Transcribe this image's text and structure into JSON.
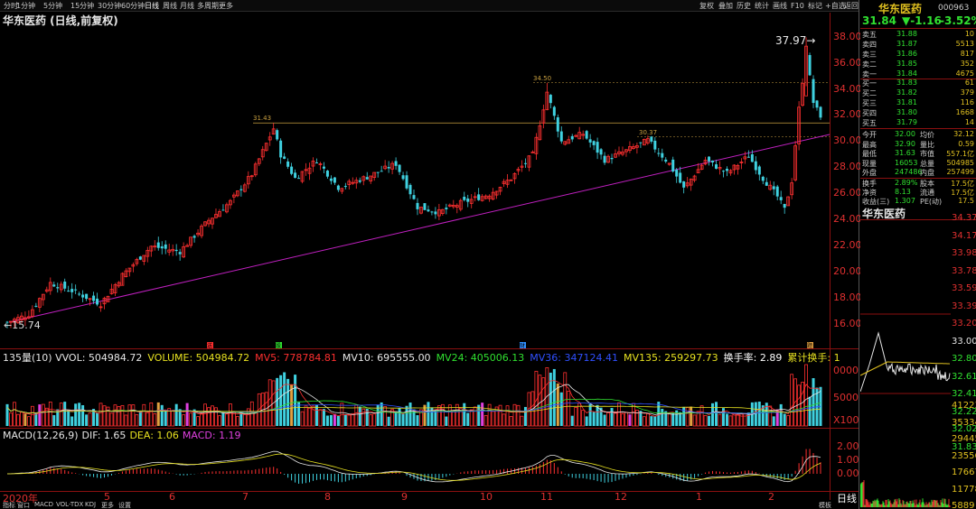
{
  "toolbar": {
    "left_tabs": [
      "分时",
      "1分钟",
      "5分钟",
      "15分钟",
      "30分钟",
      "60分钟",
      "日线",
      "周线",
      "月线",
      "多周期",
      "更多"
    ],
    "active_tab": "日线",
    "right_tabs": [
      "复权",
      "叠加",
      "历史",
      "统计",
      "画线",
      "F10",
      "标记",
      "+自选",
      "返回"
    ]
  },
  "main_title": "华东医药 (日线,前复权)",
  "colors": {
    "up": "#ff3030",
    "down": "#3fd1e0",
    "trendline": "#c020c0",
    "level": "#c9a040",
    "axis": "#e03030"
  },
  "chart_data": [
    {
      "type": "candlestick",
      "title": "华东医药 (日线,前复权)",
      "ylim": [
        14.5,
        39.0
      ],
      "y_ticks": [
        "38.00",
        "36.00",
        "34.00",
        "32.00",
        "30.00",
        "28.00",
        "26.00",
        "24.00",
        "22.00",
        "20.00",
        "18.00",
        "16.00"
      ],
      "x_labels": [
        "2020年",
        "5",
        "6",
        "7",
        "8",
        "9",
        "10",
        "11",
        "12",
        "1",
        "2"
      ],
      "annotations": [
        "15.74",
        "31.43",
        "34.50",
        "30.37",
        "37.97"
      ],
      "low_value": 15.74,
      "high_value": 37.97,
      "marked_levels": [
        31.43,
        34.5,
        30.37
      ],
      "last_close": 31.84
    },
    {
      "type": "bar",
      "title": "135量(10) VVOL",
      "series": [
        {
          "name": "VVOL",
          "value": 504984.72
        },
        {
          "name": "VOLUME",
          "value": 504984.72
        },
        {
          "name": "MV5",
          "value": 778784.81
        },
        {
          "name": "MV10",
          "value": 695555.0
        },
        {
          "name": "MV24",
          "value": 405006.13
        },
        {
          "name": "MV36",
          "value": 347124.41
        },
        {
          "name": "MV135",
          "value": 259297.73
        }
      ],
      "y_ticks": [
        "0000",
        "5000",
        "X100"
      ],
      "extra": [
        "换手率: 2.89",
        "累计换手: 1"
      ],
      "markers": [
        "送",
        "股",
        "财",
        "题"
      ]
    },
    {
      "type": "line",
      "title": "MACD(12,26,9)",
      "series": [
        {
          "name": "DIF",
          "value": 1.65
        },
        {
          "name": "DEA",
          "value": 1.06
        },
        {
          "name": "MACD",
          "value": 1.19
        }
      ],
      "y_ticks": [
        "2.00",
        "1.00",
        "0.00"
      ]
    }
  ],
  "header_labels": {
    "vol_prefix": "135量(10) VVOL: 504984.72",
    "vol_volume": "VOLUME: 504984.72",
    "vol_mv5": "MV5: 778784.81",
    "vol_mv10": "MV10: 695555.00",
    "vol_mv24": "MV24: 405006.13",
    "vol_mv36": "MV36: 347124.41",
    "vol_mv135": "MV135: 259297.73",
    "vol_turn": "换手率: 2.89",
    "vol_cum": "累计换手: 1",
    "macd_name": "MACD(12,26,9)",
    "macd_dif": "DIF: 1.65",
    "macd_dea": "DEA: 1.06",
    "macd_val": "MACD: 1.19"
  },
  "bottom_tabs": [
    "指标",
    "窗口",
    "MACD",
    "VOL-TDX",
    "KDJ",
    "更多",
    "设置"
  ],
  "bottom_right": [
    "模板",
    "日线"
  ],
  "quote": {
    "name": "华东医药",
    "code": "000963",
    "price": "31.84",
    "change": "▼-1.16",
    "pct": "-3.52%",
    "asks": [
      {
        "label": "卖五",
        "price": "31.88",
        "vol": "10"
      },
      {
        "label": "卖四",
        "price": "31.87",
        "vol": "5513"
      },
      {
        "label": "卖三",
        "price": "31.86",
        "vol": "817"
      },
      {
        "label": "卖二",
        "price": "31.85",
        "vol": "352"
      },
      {
        "label": "卖一",
        "price": "31.84",
        "vol": "4675"
      }
    ],
    "bids": [
      {
        "label": "买一",
        "price": "31.83",
        "vol": "61"
      },
      {
        "label": "买二",
        "price": "31.82",
        "vol": "379"
      },
      {
        "label": "买三",
        "price": "31.81",
        "vol": "116"
      },
      {
        "label": "买四",
        "price": "31.80",
        "vol": "1668"
      },
      {
        "label": "买五",
        "price": "31.79",
        "vol": "14"
      }
    ],
    "stats": [
      {
        "l1": "今开",
        "v1": "32.00",
        "l2": "均价",
        "v2": "32.12"
      },
      {
        "l1": "最高",
        "v1": "32.90",
        "l2": "量比",
        "v2": "0.59"
      },
      {
        "l1": "最低",
        "v1": "31.63",
        "l2": "市值",
        "v2": "557.1亿"
      },
      {
        "l1": "现量",
        "v1": "16053",
        "l2": "总量",
        "v2": "504985"
      },
      {
        "l1": "外盘",
        "v1": "247486",
        "l2": "内盘",
        "v2": "257499"
      }
    ],
    "stats2": [
      {
        "l1": "换手",
        "v1": "2.89%",
        "l2": "股本",
        "v2": "17.5亿"
      },
      {
        "l1": "净资",
        "v1": "8.13",
        "l2": "流通",
        "v2": "17.5亿"
      },
      {
        "l1": "收益(三)",
        "v1": "1.307",
        "l2": "PE(动)",
        "v2": "17.5"
      }
    ],
    "mini_title": "华东医药",
    "mini_prices": [
      "34.37",
      "34.17",
      "33.98",
      "33.78",
      "33.59",
      "33.39",
      "33.20",
      "33.00",
      "32.80",
      "32.61",
      "32.41",
      "32.22",
      "32.02",
      "31.83"
    ],
    "mini_vols": [
      "41223",
      "35334",
      "29445",
      "23556",
      "17667",
      "11778",
      "5889"
    ]
  }
}
